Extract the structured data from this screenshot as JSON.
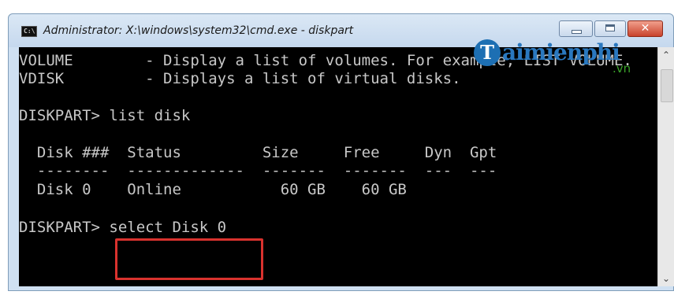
{
  "window": {
    "title": "Administrator: X:\\windows\\system32\\cmd.exe - diskpart",
    "icon": "cmd-icon",
    "controls": {
      "minimize": "minimize-icon",
      "maximize": "maximize-icon",
      "close_glyph": "✕"
    }
  },
  "console": {
    "lines": [
      "VOLUME        - Display a list of volumes. For example, LIST VOLUME.",
      "VDISK         - Displays a list of virtual disks.",
      "",
      "DISKPART> list disk",
      "",
      "  Disk ###  Status         Size     Free     Dyn  Gpt",
      "  --------  -------------  -------  -------  ---  ---",
      "  Disk 0    Online           60 GB    60 GB",
      "",
      "DISKPART> select Disk 0"
    ]
  },
  "watermark": {
    "logo_letter": "T",
    "text": "aimienphi",
    "suffix": ".vn"
  },
  "scrollbar": {
    "up_arrow": "⌃",
    "down_arrow": "⌄"
  },
  "colors": {
    "console_bg": "#000000",
    "console_text": "#c8c8c8",
    "highlight_border": "#d9322e",
    "titlebar": "#cfe0f2"
  }
}
